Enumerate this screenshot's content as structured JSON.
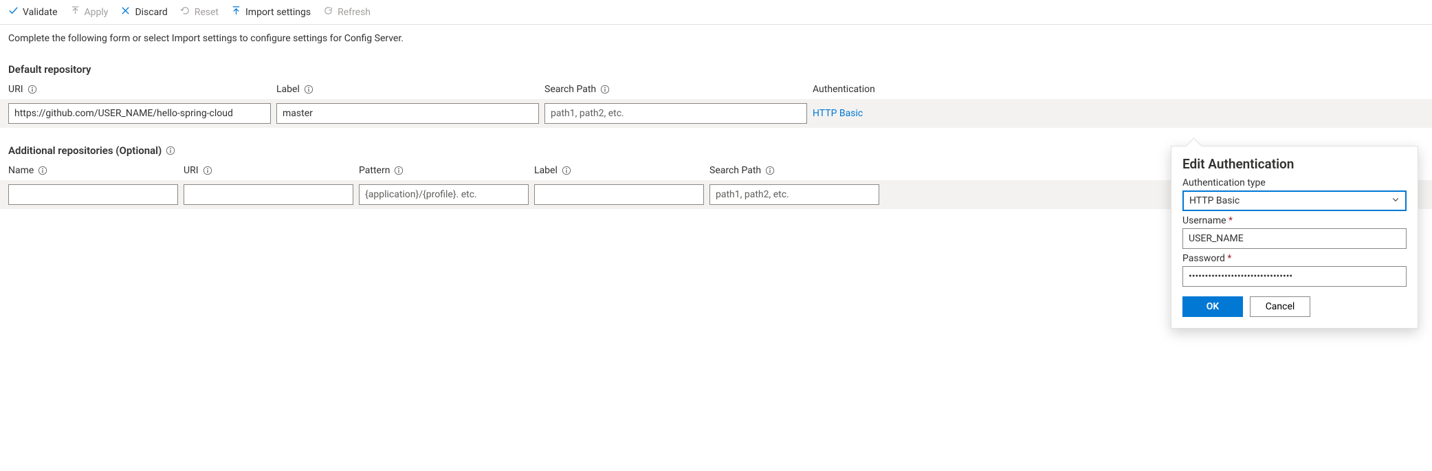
{
  "toolbar": {
    "validate": "Validate",
    "apply": "Apply",
    "discard": "Discard",
    "reset": "Reset",
    "import": "Import settings",
    "refresh": "Refresh"
  },
  "intro": "Complete the following form or select Import settings to configure settings for Config Server.",
  "default_repo": {
    "title": "Default repository",
    "headers": {
      "uri": "URI",
      "label": "Label",
      "search_path": "Search Path",
      "auth": "Authentication"
    },
    "uri_value": "https://github.com/USER_NAME/hello-spring-cloud",
    "label_value": "master",
    "search_path_placeholder": "path1, path2, etc.",
    "auth_link": "HTTP Basic"
  },
  "additional": {
    "title": "Additional repositories (Optional)",
    "headers": {
      "name": "Name",
      "uri": "URI",
      "pattern": "Pattern",
      "label": "Label",
      "search_path": "Search Path"
    },
    "pattern_placeholder": "{application}/{profile}. etc.",
    "search_path_placeholder": "path1, path2, etc."
  },
  "auth_popover": {
    "title": "Edit Authentication",
    "type_label": "Authentication type",
    "type_value": "HTTP Basic",
    "username_label": "Username",
    "username_value": "USER_NAME",
    "password_label": "Password",
    "password_value": "••••••••••••••••••••••••••••••••",
    "ok": "OK",
    "cancel": "Cancel"
  }
}
